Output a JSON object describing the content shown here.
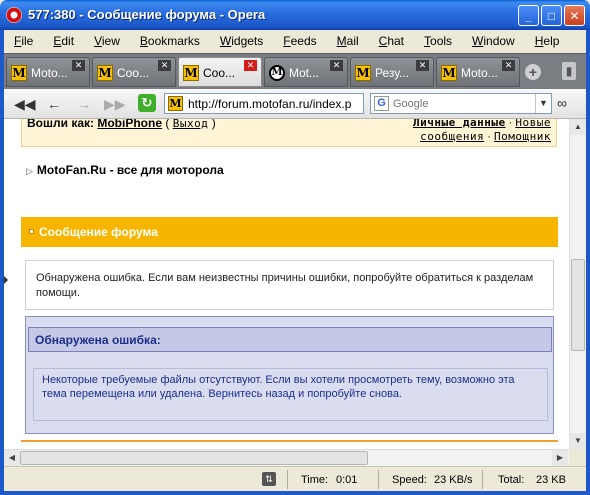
{
  "window": {
    "title": "577:380 - Сообщение форума - Opera",
    "controls": {
      "minimize": "_",
      "maximize": "□",
      "close": "✕"
    }
  },
  "menu": [
    "File",
    "Edit",
    "View",
    "Bookmarks",
    "Widgets",
    "Feeds",
    "Mail",
    "Chat",
    "Tools",
    "Window",
    "Help"
  ],
  "tabs": [
    {
      "label": "Moto...",
      "icon": "motofan-icon",
      "active": false
    },
    {
      "label": "Соо...",
      "icon": "motofan-icon",
      "active": false
    },
    {
      "label": "Соо...",
      "icon": "motofan-icon",
      "active": true
    },
    {
      "label": "Mot...",
      "icon": "motorola-icon",
      "active": false
    },
    {
      "label": "Резу...",
      "icon": "motofan-icon",
      "active": false
    },
    {
      "label": "Moto...",
      "icon": "motofan-icon",
      "active": false
    }
  ],
  "toolbar": {
    "url": "http://forum.motofan.ru/index.p",
    "search_placeholder": "Google",
    "search_engine": "G"
  },
  "page": {
    "login_prefix": "Вошли как:",
    "username": "MobiPhone",
    "logout_open": "(",
    "logout": "Выход",
    "logout_close": ")",
    "personal_data": "Личные данные",
    "separator": "·",
    "new": "Новые",
    "messages": "сообщения",
    "helper": "Помощник",
    "forum_title": "MotoFan.Ru - все для моторола",
    "section_header": "Сообщение форума",
    "notice": "Обнаружена ошибка. Если вам неизвестны причины ошибки, попробуйте обратиться к разделам помощи.",
    "error_title": "Обнаружена ошибка:",
    "error_body": "Некоторые требуемые файлы отсутствуют. Если вы хотели просмотреть тему, возможно эта тема перемещена или удалена. Вернитесь назад и попробуйте снова."
  },
  "status": {
    "time_label": "Time:",
    "time": "0:01",
    "speed_label": "Speed:",
    "speed": "23 KB/s",
    "total_label": "Total:",
    "total": "23 KB"
  },
  "colors": {
    "section_header_bg": "#f7b500",
    "error_text": "#1b2f8a",
    "login_bar_bg": "#fff5d6"
  }
}
